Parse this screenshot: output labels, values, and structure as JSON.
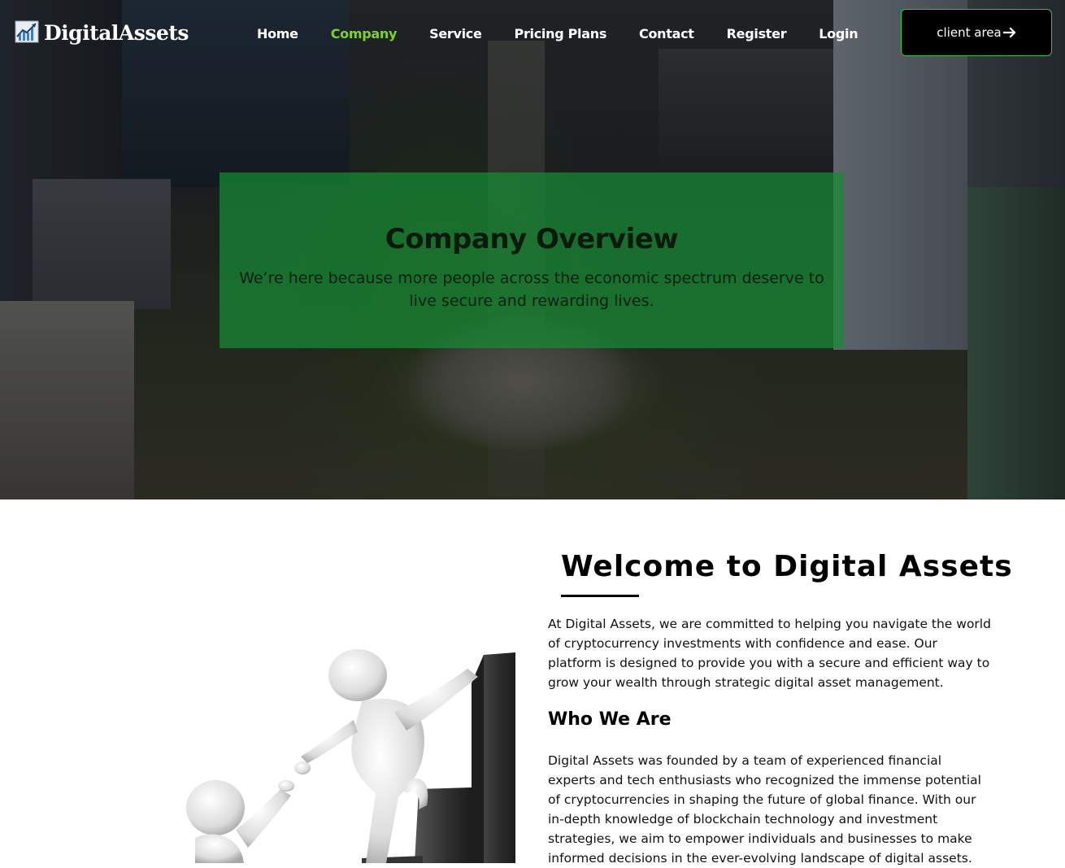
{
  "brand": {
    "name": "DigitalAssets",
    "icon": "chart-logo-icon"
  },
  "nav": {
    "items": [
      {
        "label": "Home",
        "active": false
      },
      {
        "label": "Company",
        "active": true
      },
      {
        "label": "Service",
        "active": false
      },
      {
        "label": "Pricing Plans",
        "active": false
      },
      {
        "label": "Contact",
        "active": false
      },
      {
        "label": "Register",
        "active": false
      },
      {
        "label": "Login",
        "active": false
      }
    ],
    "active_color": "#7ed321"
  },
  "client_button": {
    "label": "client area",
    "icon": "arrow-right-icon",
    "border_color": "#33c24d"
  },
  "hero": {
    "title": "Company Overview",
    "subtitle": "We’re here because more people across the economic spectrum deserve to live secure and rewarding lives.",
    "box_color": "#168c34"
  },
  "main": {
    "heading": "Welcome to Digital Assets",
    "intro": "At Digital Assets, we are committed to helping you navigate the world of cryptocurrency investments with confidence and ease. Our platform is designed to provide you with a secure and efficient way to grow your wealth through strategic digital asset management.",
    "who_heading": "Who We Are",
    "who_text": "Digital Assets was founded by a team of experienced financial experts and tech enthusiasts who recognized the immense potential of cryptocurrencies in shaping the future of global finance. With our in-depth knowledge of blockchain technology and investment strategies, we aim to empower individuals and businesses to make informed decisions in the ever-evolving landscape of digital assets."
  }
}
